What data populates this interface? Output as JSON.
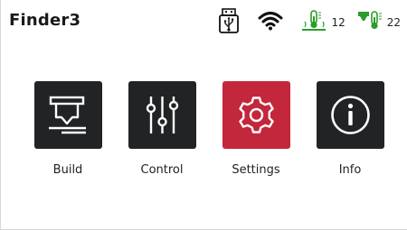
{
  "header": {
    "device_name": "Finder3",
    "status": {
      "usb_icon": "usb-drive-icon",
      "wifi_icon": "wifi-icon",
      "bed_temperature": "12",
      "nozzle_temperature": "22"
    }
  },
  "menu": {
    "items": [
      {
        "label": "Build",
        "icon": "build-nozzle-icon",
        "selected": false
      },
      {
        "label": "Control",
        "icon": "sliders-icon",
        "selected": false
      },
      {
        "label": "Settings",
        "icon": "gear-icon",
        "selected": true
      },
      {
        "label": "Info",
        "icon": "info-icon",
        "selected": false
      }
    ]
  },
  "colors": {
    "tile": "#222324",
    "tile_selected": "#c3273c",
    "temperature_icon": "#2a9d2a"
  }
}
